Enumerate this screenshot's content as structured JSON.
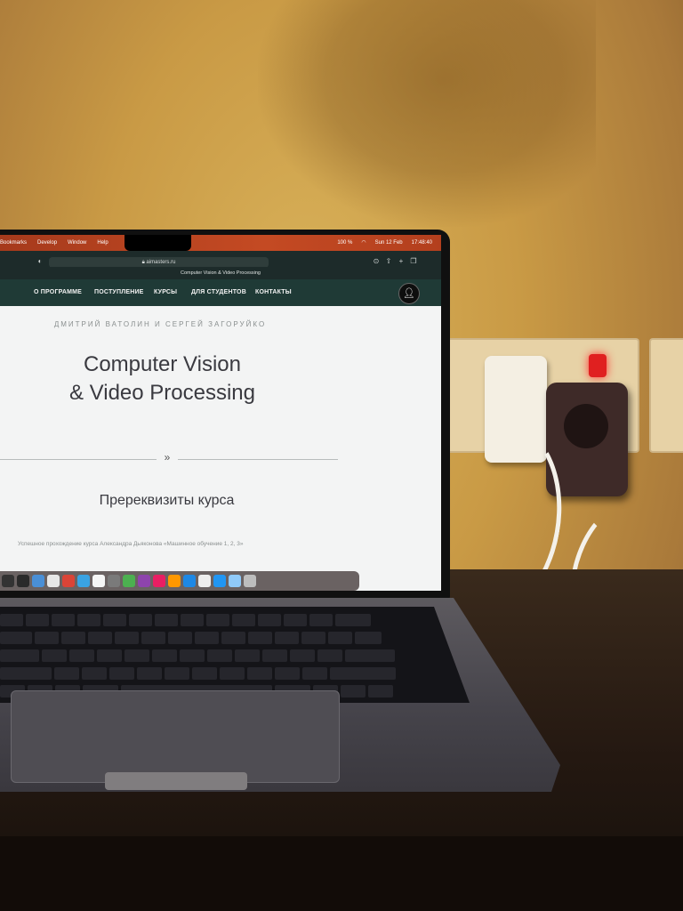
{
  "menubar": {
    "items": [
      "Bookmarks",
      "Develop",
      "Window",
      "Help"
    ],
    "battery": "100 %",
    "date": "Sun 12 Feb",
    "time": "17:48:40"
  },
  "browser": {
    "url": "aimasters.ru",
    "tab_title": "Computer Vision & Video Processing"
  },
  "site": {
    "nav": [
      "О ПРОГРАММЕ",
      "ПОСТУПЛЕНИЕ",
      "КУРСЫ",
      "ДЛЯ СТУДЕНТОВ",
      "КОНТАКТЫ"
    ],
    "authors": "ДМИТРИЙ ВАТОЛИН И СЕРГЕЙ ЗАГОРУЙКО",
    "title_line1": "Computer Vision",
    "title_line2": "& Video Processing",
    "divider_glyph": "»",
    "section_title": "Пререквизиты курса",
    "prereq_text": "Успешное прохождение курса Александра Дьяконова «Машинное обучение 1, 2, 3»"
  },
  "colors": {
    "wall": "#c99a45",
    "menubar": "#c44a23",
    "site_nav": "#1f3a36",
    "page_bg": "#f3f4f4",
    "laptop": "#5d5a5f"
  }
}
